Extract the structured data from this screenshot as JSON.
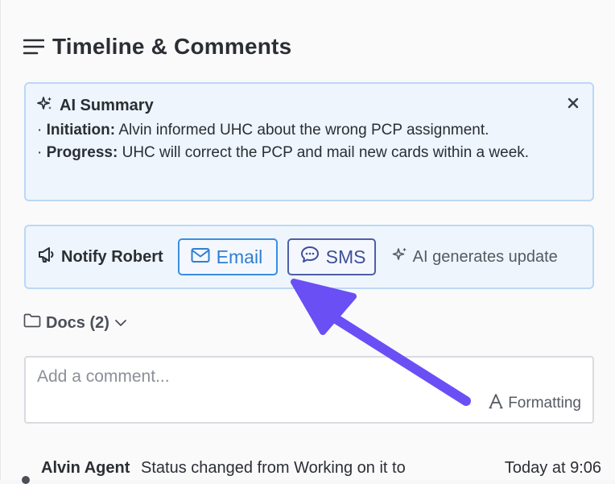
{
  "header": {
    "title": "Timeline & Comments",
    "icon": "list-icon"
  },
  "summary": {
    "title": "AI Summary",
    "icon": "sparkle-icon",
    "close_icon": "close-icon",
    "items": [
      {
        "label": "Initiation:",
        "text": " Alvin informed UHC about the wrong PCP assignment."
      },
      {
        "label": "Progress:",
        "text": " UHC will correct the PCP and mail new cards within a week."
      }
    ]
  },
  "notify": {
    "label": "Notify Robert",
    "icon": "megaphone-icon",
    "email_label": "Email",
    "sms_label": "SMS",
    "ai_label": "AI generates update"
  },
  "docs": {
    "label": "Docs (2)"
  },
  "comment": {
    "placeholder": "Add a comment...",
    "formatting_label": "Formatting"
  },
  "timeline": [
    {
      "author": "Alvin Agent",
      "message": "Status changed from Working on it to",
      "time": "Today at 9:06"
    }
  ],
  "colors": {
    "accent_blue": "#3a8ee0",
    "sms_blue": "#4f5fa6",
    "card_bg": "#eef5fd",
    "card_border": "#bcd7f5",
    "annotation_arrow": "#6a4ff5"
  }
}
